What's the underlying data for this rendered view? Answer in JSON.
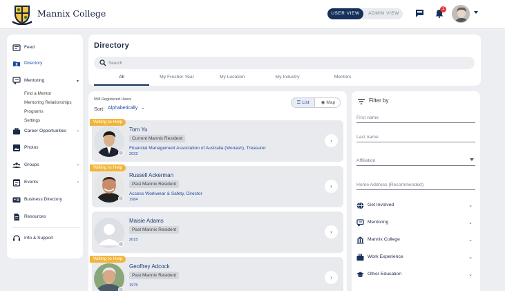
{
  "header": {
    "brand": "Mannix College",
    "user_view_label": "USER VIEW",
    "admin_view_label": "ADMIN VIEW",
    "notification_count": "1"
  },
  "sidebar": {
    "items": [
      {
        "label": "Feed",
        "icon": "feed-icon"
      },
      {
        "label": "Directory",
        "icon": "directory-icon"
      },
      {
        "label": "Mentoring",
        "icon": "mentoring-icon"
      },
      {
        "label": "Career Opportunities",
        "icon": "briefcase-icon"
      },
      {
        "label": "Photos",
        "icon": "photo-icon"
      },
      {
        "label": "Groups",
        "icon": "groups-icon"
      },
      {
        "label": "Events",
        "icon": "calendar-icon"
      },
      {
        "label": "Business Directory",
        "icon": "business-card-icon"
      },
      {
        "label": "Resources",
        "icon": "document-icon"
      },
      {
        "label": "Info & Support",
        "icon": "support-icon"
      }
    ],
    "mentoring_sub": [
      "Find a Mentor",
      "Mentoring Relationships",
      "Programs",
      "Settings"
    ]
  },
  "directory": {
    "title": "Directory",
    "search_placeholder": "Search",
    "tabs": [
      "All",
      "My Fresher Year",
      "My Location",
      "My Industry",
      "Mentors"
    ]
  },
  "results": {
    "registered": "558 Registered Users",
    "sort_label": "Sort:",
    "sort_value": "Alphabetically",
    "list_label": "List",
    "map_label": "Map",
    "willing_label": "Willing to Help",
    "cards": [
      {
        "name": "Tom Yu",
        "tag": "Current Mannix Resident",
        "role": "Financial Management Association of Australia (Monash), Treasurer",
        "year": "2022",
        "willing": true
      },
      {
        "name": "Russell Ackerman",
        "tag": "Past Mannix Resident",
        "role": "Access Workwear & Safety, Director",
        "year": "1984",
        "willing": true
      },
      {
        "name": "Maisie Adams",
        "tag": "Past Mannix Resident",
        "role": "",
        "year": "2015",
        "willing": false
      },
      {
        "name": "Geoffrey Adcock",
        "tag": "Past Mannix Resident",
        "role": "",
        "year": "1975",
        "willing": true
      }
    ]
  },
  "filter": {
    "title": "Filter by",
    "first_name_placeholder": "First name",
    "last_name_placeholder": "Last name",
    "affiliation_placeholder": "Affiliation",
    "home_address_placeholder": "Home Address (Recommended)",
    "sections": [
      "Get Involved",
      "Mentoring",
      "Mannix College",
      "Work Experience",
      "Other Education"
    ]
  },
  "colors": {
    "navy": "#15305a",
    "link": "#1f4aa5",
    "willing": "#f2b53a",
    "badge": "#e53935"
  }
}
